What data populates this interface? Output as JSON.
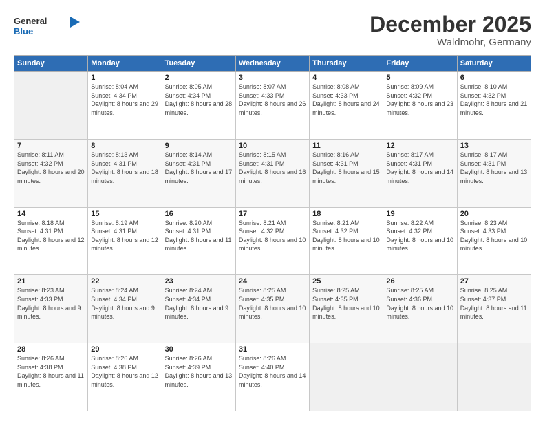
{
  "header": {
    "logo_line1": "General",
    "logo_line2": "Blue",
    "month": "December 2025",
    "location": "Waldmohr, Germany"
  },
  "weekdays": [
    "Sunday",
    "Monday",
    "Tuesday",
    "Wednesday",
    "Thursday",
    "Friday",
    "Saturday"
  ],
  "weeks": [
    [
      {
        "day": "",
        "sunrise": "",
        "sunset": "",
        "daylight": ""
      },
      {
        "day": "1",
        "sunrise": "Sunrise: 8:04 AM",
        "sunset": "Sunset: 4:34 PM",
        "daylight": "Daylight: 8 hours and 29 minutes."
      },
      {
        "day": "2",
        "sunrise": "Sunrise: 8:05 AM",
        "sunset": "Sunset: 4:34 PM",
        "daylight": "Daylight: 8 hours and 28 minutes."
      },
      {
        "day": "3",
        "sunrise": "Sunrise: 8:07 AM",
        "sunset": "Sunset: 4:33 PM",
        "daylight": "Daylight: 8 hours and 26 minutes."
      },
      {
        "day": "4",
        "sunrise": "Sunrise: 8:08 AM",
        "sunset": "Sunset: 4:33 PM",
        "daylight": "Daylight: 8 hours and 24 minutes."
      },
      {
        "day": "5",
        "sunrise": "Sunrise: 8:09 AM",
        "sunset": "Sunset: 4:32 PM",
        "daylight": "Daylight: 8 hours and 23 minutes."
      },
      {
        "day": "6",
        "sunrise": "Sunrise: 8:10 AM",
        "sunset": "Sunset: 4:32 PM",
        "daylight": "Daylight: 8 hours and 21 minutes."
      }
    ],
    [
      {
        "day": "7",
        "sunrise": "Sunrise: 8:11 AM",
        "sunset": "Sunset: 4:32 PM",
        "daylight": "Daylight: 8 hours and 20 minutes."
      },
      {
        "day": "8",
        "sunrise": "Sunrise: 8:13 AM",
        "sunset": "Sunset: 4:31 PM",
        "daylight": "Daylight: 8 hours and 18 minutes."
      },
      {
        "day": "9",
        "sunrise": "Sunrise: 8:14 AM",
        "sunset": "Sunset: 4:31 PM",
        "daylight": "Daylight: 8 hours and 17 minutes."
      },
      {
        "day": "10",
        "sunrise": "Sunrise: 8:15 AM",
        "sunset": "Sunset: 4:31 PM",
        "daylight": "Daylight: 8 hours and 16 minutes."
      },
      {
        "day": "11",
        "sunrise": "Sunrise: 8:16 AM",
        "sunset": "Sunset: 4:31 PM",
        "daylight": "Daylight: 8 hours and 15 minutes."
      },
      {
        "day": "12",
        "sunrise": "Sunrise: 8:17 AM",
        "sunset": "Sunset: 4:31 PM",
        "daylight": "Daylight: 8 hours and 14 minutes."
      },
      {
        "day": "13",
        "sunrise": "Sunrise: 8:17 AM",
        "sunset": "Sunset: 4:31 PM",
        "daylight": "Daylight: 8 hours and 13 minutes."
      }
    ],
    [
      {
        "day": "14",
        "sunrise": "Sunrise: 8:18 AM",
        "sunset": "Sunset: 4:31 PM",
        "daylight": "Daylight: 8 hours and 12 minutes."
      },
      {
        "day": "15",
        "sunrise": "Sunrise: 8:19 AM",
        "sunset": "Sunset: 4:31 PM",
        "daylight": "Daylight: 8 hours and 12 minutes."
      },
      {
        "day": "16",
        "sunrise": "Sunrise: 8:20 AM",
        "sunset": "Sunset: 4:31 PM",
        "daylight": "Daylight: 8 hours and 11 minutes."
      },
      {
        "day": "17",
        "sunrise": "Sunrise: 8:21 AM",
        "sunset": "Sunset: 4:32 PM",
        "daylight": "Daylight: 8 hours and 10 minutes."
      },
      {
        "day": "18",
        "sunrise": "Sunrise: 8:21 AM",
        "sunset": "Sunset: 4:32 PM",
        "daylight": "Daylight: 8 hours and 10 minutes."
      },
      {
        "day": "19",
        "sunrise": "Sunrise: 8:22 AM",
        "sunset": "Sunset: 4:32 PM",
        "daylight": "Daylight: 8 hours and 10 minutes."
      },
      {
        "day": "20",
        "sunrise": "Sunrise: 8:23 AM",
        "sunset": "Sunset: 4:33 PM",
        "daylight": "Daylight: 8 hours and 10 minutes."
      }
    ],
    [
      {
        "day": "21",
        "sunrise": "Sunrise: 8:23 AM",
        "sunset": "Sunset: 4:33 PM",
        "daylight": "Daylight: 8 hours and 9 minutes."
      },
      {
        "day": "22",
        "sunrise": "Sunrise: 8:24 AM",
        "sunset": "Sunset: 4:34 PM",
        "daylight": "Daylight: 8 hours and 9 minutes."
      },
      {
        "day": "23",
        "sunrise": "Sunrise: 8:24 AM",
        "sunset": "Sunset: 4:34 PM",
        "daylight": "Daylight: 8 hours and 9 minutes."
      },
      {
        "day": "24",
        "sunrise": "Sunrise: 8:25 AM",
        "sunset": "Sunset: 4:35 PM",
        "daylight": "Daylight: 8 hours and 10 minutes."
      },
      {
        "day": "25",
        "sunrise": "Sunrise: 8:25 AM",
        "sunset": "Sunset: 4:35 PM",
        "daylight": "Daylight: 8 hours and 10 minutes."
      },
      {
        "day": "26",
        "sunrise": "Sunrise: 8:25 AM",
        "sunset": "Sunset: 4:36 PM",
        "daylight": "Daylight: 8 hours and 10 minutes."
      },
      {
        "day": "27",
        "sunrise": "Sunrise: 8:25 AM",
        "sunset": "Sunset: 4:37 PM",
        "daylight": "Daylight: 8 hours and 11 minutes."
      }
    ],
    [
      {
        "day": "28",
        "sunrise": "Sunrise: 8:26 AM",
        "sunset": "Sunset: 4:38 PM",
        "daylight": "Daylight: 8 hours and 11 minutes."
      },
      {
        "day": "29",
        "sunrise": "Sunrise: 8:26 AM",
        "sunset": "Sunset: 4:38 PM",
        "daylight": "Daylight: 8 hours and 12 minutes."
      },
      {
        "day": "30",
        "sunrise": "Sunrise: 8:26 AM",
        "sunset": "Sunset: 4:39 PM",
        "daylight": "Daylight: 8 hours and 13 minutes."
      },
      {
        "day": "31",
        "sunrise": "Sunrise: 8:26 AM",
        "sunset": "Sunset: 4:40 PM",
        "daylight": "Daylight: 8 hours and 14 minutes."
      },
      {
        "day": "",
        "sunrise": "",
        "sunset": "",
        "daylight": ""
      },
      {
        "day": "",
        "sunrise": "",
        "sunset": "",
        "daylight": ""
      },
      {
        "day": "",
        "sunrise": "",
        "sunset": "",
        "daylight": ""
      }
    ]
  ]
}
